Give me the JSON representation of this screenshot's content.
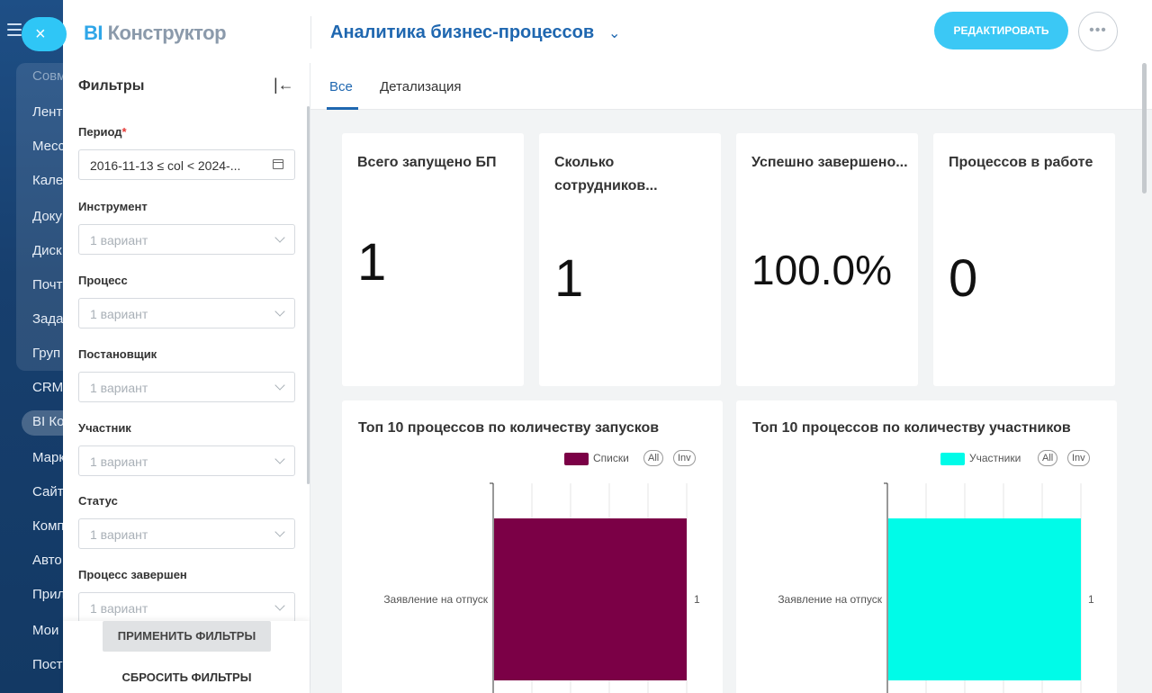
{
  "background_nav": {
    "items": [
      "Совм",
      "Лент",
      "Месс",
      "Кале",
      "Доку",
      "Диск",
      "Почт",
      "Зада",
      "Груп",
      "CRM",
      "BI Ко",
      "Марк",
      "Сайт",
      "Комп",
      "Авто",
      "Прил",
      "Мои",
      "Пост"
    ]
  },
  "header": {
    "logo_bi": "BI",
    "logo_text": "Конструктор",
    "dashboard_title": "Аналитика бизнес-процессов",
    "edit_label": "РЕДАКТИРОВАТЬ",
    "more_label": "•••",
    "close_label": "×"
  },
  "filters": {
    "title": "Фильтры",
    "fields": [
      {
        "label": "Период",
        "required": true,
        "value": "2016-11-13 ≤ col < 2024-...",
        "type": "date"
      },
      {
        "label": "Инструмент",
        "placeholder": "1 вариант"
      },
      {
        "label": "Процесс",
        "placeholder": "1 вариант"
      },
      {
        "label": "Постановщик",
        "placeholder": "1 вариант"
      },
      {
        "label": "Участник",
        "placeholder": "1 вариант"
      },
      {
        "label": "Статус",
        "placeholder": "1 вариант"
      },
      {
        "label": "Процесс завершен",
        "placeholder": "1 вариант"
      }
    ],
    "apply_label": "ПРИМЕНИТЬ ФИЛЬТРЫ",
    "reset_label": "СБРОСИТЬ ФИЛЬТРЫ"
  },
  "tabs": [
    {
      "label": "Все",
      "active": true
    },
    {
      "label": "Детализация",
      "active": false
    }
  ],
  "kpis": [
    {
      "title": "Всего запущено БП",
      "value": "1"
    },
    {
      "title": "Сколько сотрудников...",
      "value": "1"
    },
    {
      "title": "Успешно завершено...",
      "value": "100.0%"
    },
    {
      "title": "Процессов в работе",
      "value": "0"
    }
  ],
  "chart_data": [
    {
      "type": "bar",
      "orientation": "horizontal",
      "title": "Топ 10 процессов по количеству запусков",
      "categories": [
        "Заявление на отпуск"
      ],
      "series": [
        {
          "name": "Списки",
          "values": [
            1
          ],
          "color": "#7b0046"
        }
      ],
      "legend_buttons": [
        "All",
        "Inv"
      ],
      "data_labels": [
        "1"
      ],
      "grid": true,
      "legend_position": "top-right"
    },
    {
      "type": "bar",
      "orientation": "horizontal",
      "title": "Топ 10 процессов по количеству участников",
      "categories": [
        "Заявление на отпуск"
      ],
      "series": [
        {
          "name": "Участники",
          "values": [
            1
          ],
          "color": "#00fbe8"
        }
      ],
      "legend_buttons": [
        "All",
        "Inv"
      ],
      "data_labels": [
        "1"
      ],
      "grid": true,
      "legend_position": "top-right"
    }
  ]
}
